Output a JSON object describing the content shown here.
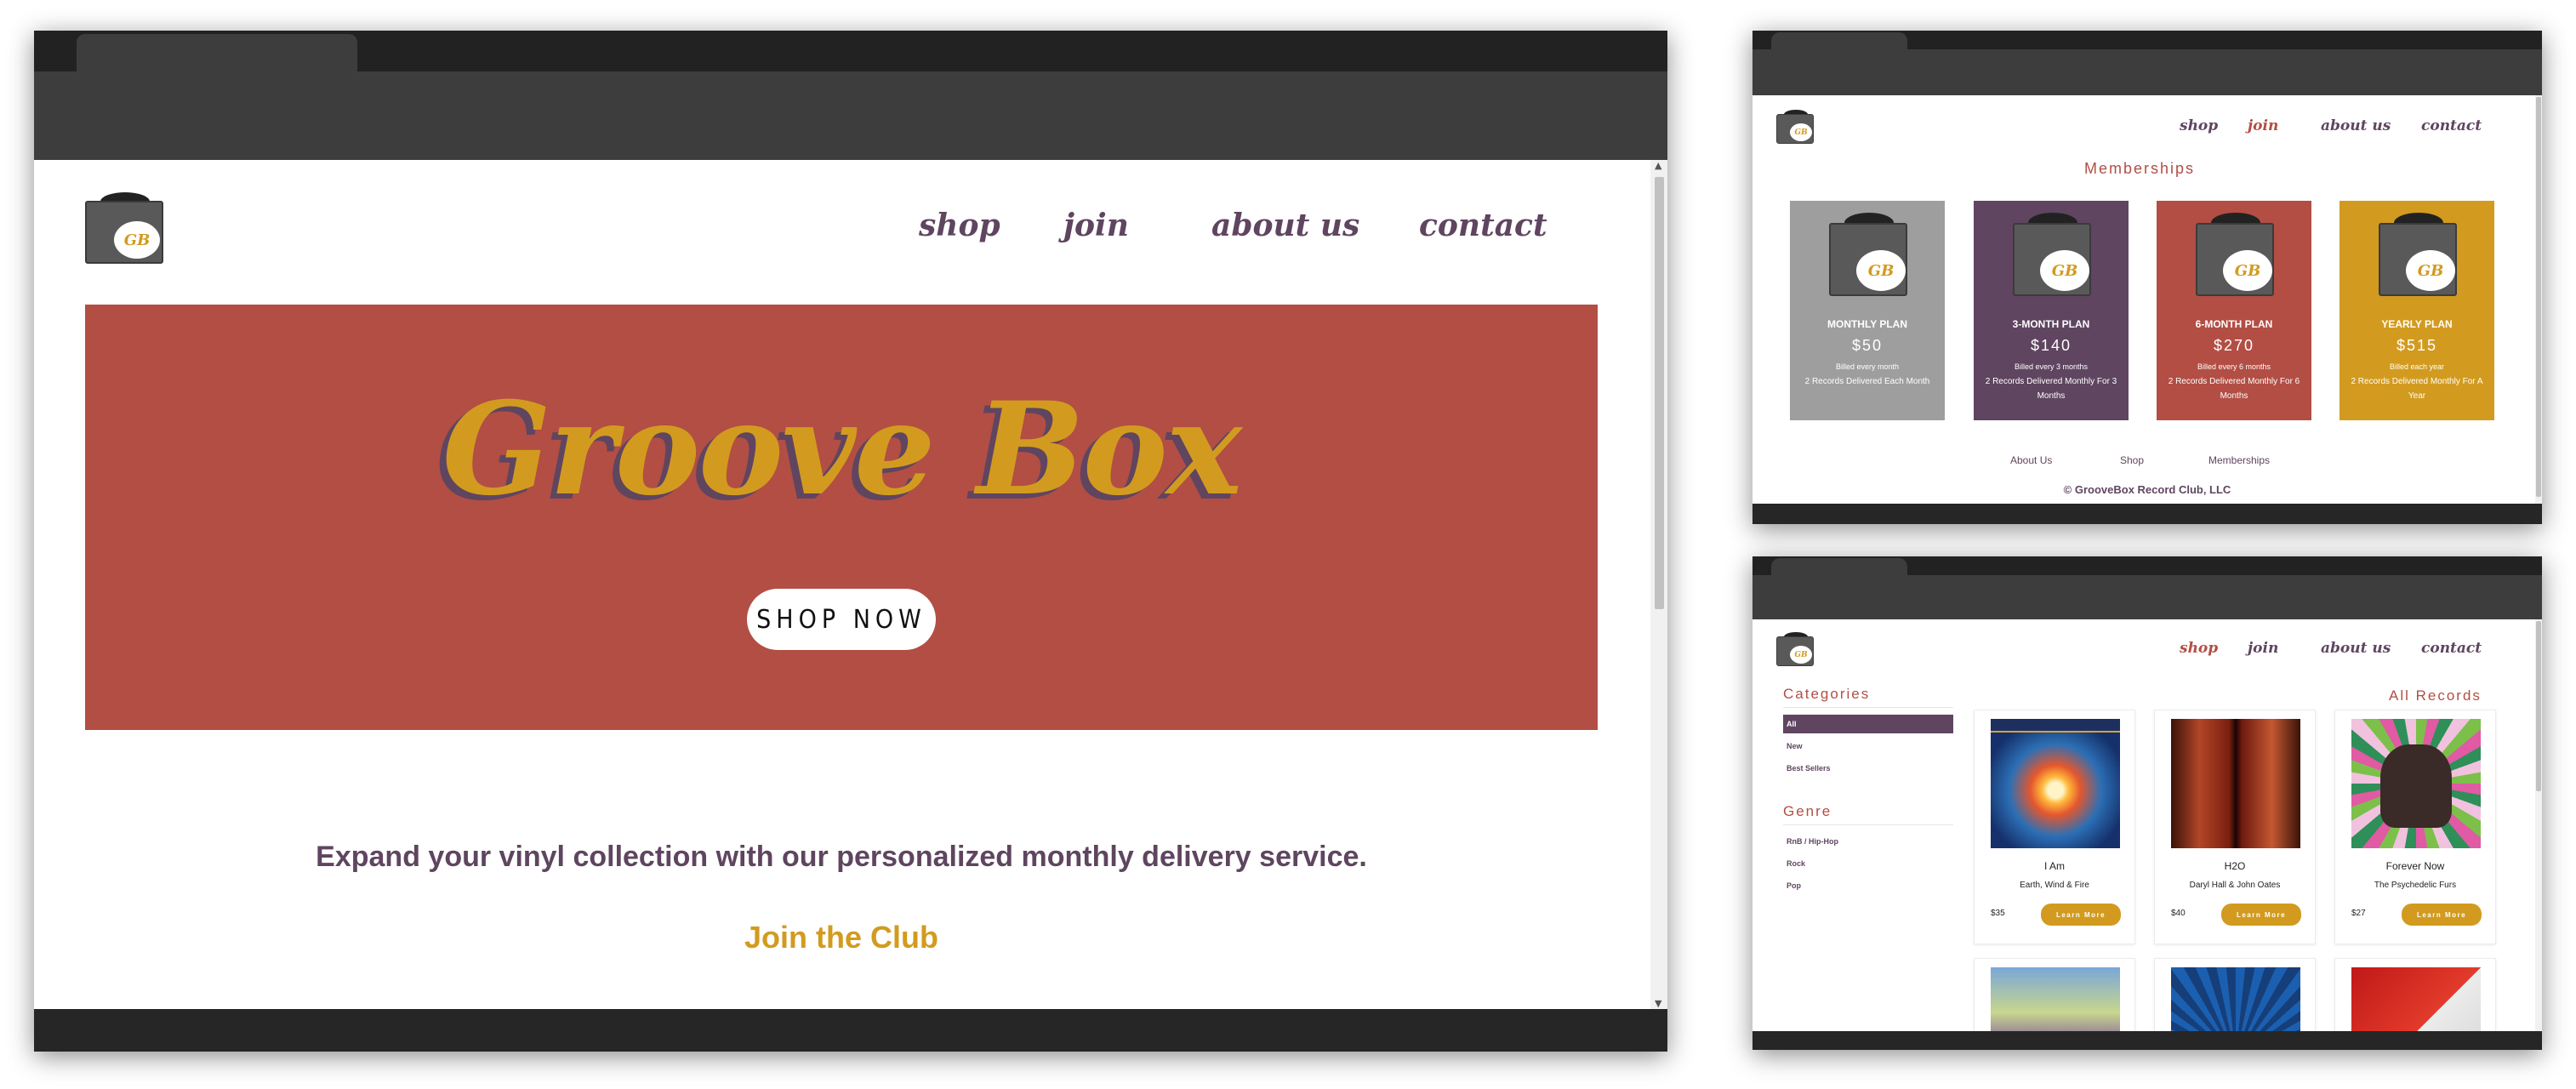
{
  "colors": {
    "plum": "#5f4560",
    "brick": "#b24e44",
    "gold": "#d29b1f",
    "gray": "#9e9e9e"
  },
  "main": {
    "nav": [
      "shop",
      "join",
      "about us",
      "contact"
    ],
    "hero_title": "Groove Box",
    "shop_now": "SHOP NOW",
    "tagline": "Expand your vinyl collection with our personalized monthly delivery service.",
    "join_club": "Join the Club",
    "logo_text": "GB"
  },
  "memberships": {
    "nav": [
      "shop",
      "join",
      "about us",
      "contact"
    ],
    "title": "Memberships",
    "plans": [
      {
        "name": "MONTHLY PLAN",
        "price": "$50",
        "billing": "Billed every month",
        "desc": "2 Records Delivered Each Month",
        "color": "#9e9e9e"
      },
      {
        "name": "3-MONTH PLAN",
        "price": "$140",
        "billing": "Billed every 3 months",
        "desc": "2 Records Delivered Monthly For 3 Months",
        "color": "#5f4560"
      },
      {
        "name": "6-MONTH PLAN",
        "price": "$270",
        "billing": "Billed every 6 months",
        "desc": "2 Records Delivered Monthly For 6 Months",
        "color": "#b24e44"
      },
      {
        "name": "YEARLY PLAN",
        "price": "$515",
        "billing": "Billed each year",
        "desc": "2 Records Delivered Monthly For A Year",
        "color": "#d29b1f"
      }
    ],
    "footer_links": [
      "About Us",
      "Shop",
      "Memberships"
    ],
    "copyright": "© GrooveBox Record Club, LLC"
  },
  "shop": {
    "nav": [
      "shop",
      "join",
      "about us",
      "contact"
    ],
    "categories_title": "Categories",
    "categories": [
      "All",
      "New",
      "Best Sellers"
    ],
    "genre_title": "Genre",
    "genres": [
      "RnB / Hip-Hop",
      "Rock",
      "Pop"
    ],
    "all_records_title": "All Records",
    "learn_more": "Learn More",
    "records": [
      {
        "title": "I Am",
        "artist": "Earth, Wind & Fire",
        "price": "$35"
      },
      {
        "title": "H2O",
        "artist": "Daryl Hall & John Oates",
        "price": "$40"
      },
      {
        "title": "Forever Now",
        "artist": "The Psychedelic Furs",
        "price": "$27"
      }
    ]
  }
}
